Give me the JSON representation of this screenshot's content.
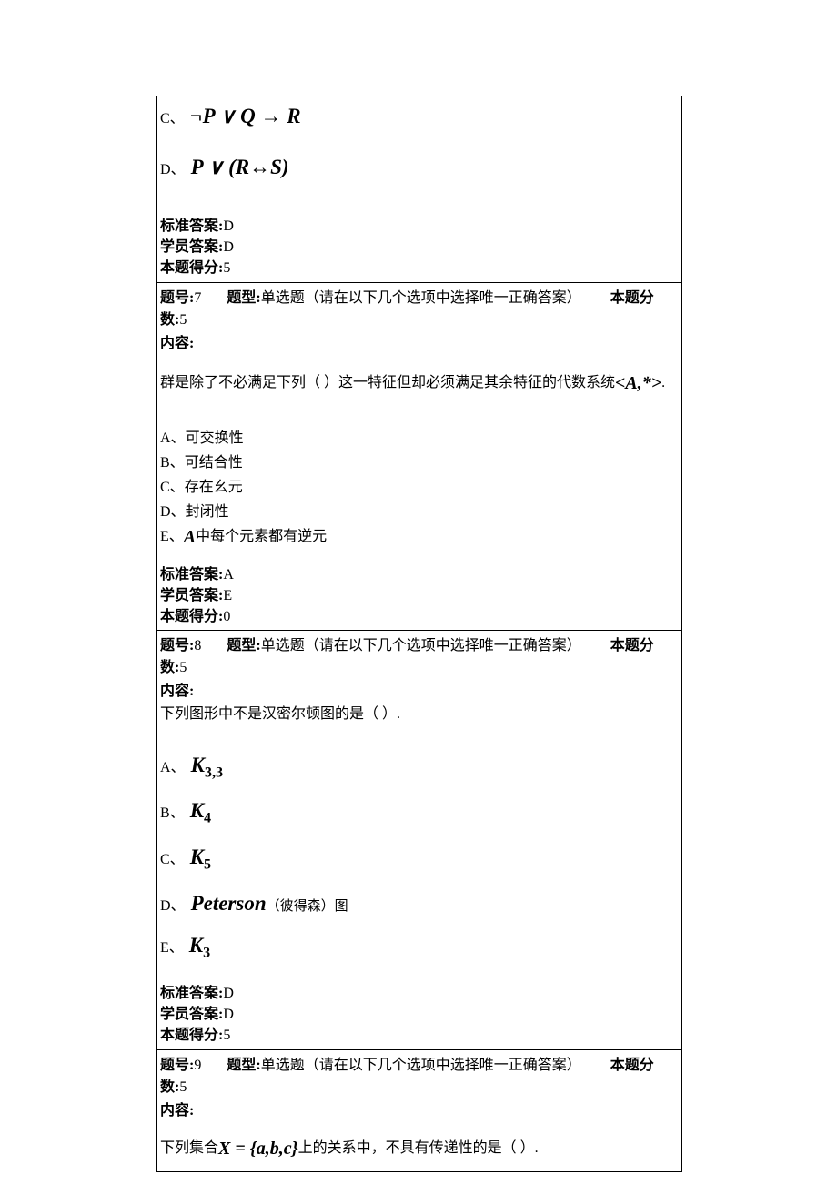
{
  "q6": {
    "opt_c_letter": "C、",
    "opt_c_math": "¬P ∨ Q → R",
    "opt_d_letter": "D、",
    "opt_d_math_left": "P ∨ (R",
    "opt_d_math_arrow": "↔",
    "opt_d_math_right": "S)",
    "std_answer_label": "标准答案:",
    "std_answer_value": "D",
    "stu_answer_label": "学员答案:",
    "stu_answer_value": "D",
    "score_label": "本题得分:",
    "score_value": "5"
  },
  "q7": {
    "num_label": "题号:",
    "num_value": "7",
    "type_label": "题型:",
    "type_value": "单选题（请在以下几个选项中选择唯一正确答案）",
    "points_label": "本题分数:",
    "points_value": "5",
    "content_label": "内容:",
    "stem_pre": "群是除了不必满足下列（ ）这一特征但却必须满足其余特征的代数系统",
    "stem_math": "<A,*>",
    "stem_suffix": ".",
    "a_letter": "A、",
    "a_text": "可交换性",
    "b_letter": "B、",
    "b_text": "可结合性",
    "c_letter": "C、",
    "c_text": "存在幺元",
    "d_letter": "D、",
    "d_text": "封闭性",
    "e_letter": "E、",
    "e_math": "A",
    "e_suffix": "中每个元素都有逆元",
    "std_answer_label": "标准答案:",
    "std_answer_value": "A",
    "stu_answer_label": "学员答案:",
    "stu_answer_value": "E",
    "score_label": "本题得分:",
    "score_value": "0"
  },
  "q8": {
    "num_label": "题号:",
    "num_value": "8",
    "type_label": "题型:",
    "type_value": "单选题（请在以下几个选项中选择唯一正确答案）",
    "points_label": "本题分数:",
    "points_value": "5",
    "content_label": "内容:",
    "stem": "下列图形中不是汉密尔顿图的是（ ）.",
    "a_letter": "A、",
    "a_math_base": "K",
    "a_math_sub": "3,3",
    "b_letter": "B、",
    "b_math_base": "K",
    "b_math_sub": "4",
    "c_letter": "C、",
    "c_math_base": "K",
    "c_math_sub": "5",
    "d_letter": "D、",
    "d_math": "Peterson",
    "d_note": "（彼得森）图",
    "e_letter": "E、",
    "e_math_base": "K",
    "e_math_sub": "3",
    "std_answer_label": "标准答案:",
    "std_answer_value": "D",
    "stu_answer_label": "学员答案:",
    "stu_answer_value": "D",
    "score_label": "本题得分:",
    "score_value": "5"
  },
  "q9": {
    "num_label": "题号:",
    "num_value": "9",
    "type_label": "题型:",
    "type_value": "单选题（请在以下几个选项中选择唯一正确答案）",
    "points_label": "本题分数:",
    "points_value": "5",
    "content_label": "内容:",
    "stem_pre": "下列集合",
    "stem_math": "X = {a,b,c}",
    "stem_post": "上的关系中，不具有传递性的是（ ）."
  }
}
